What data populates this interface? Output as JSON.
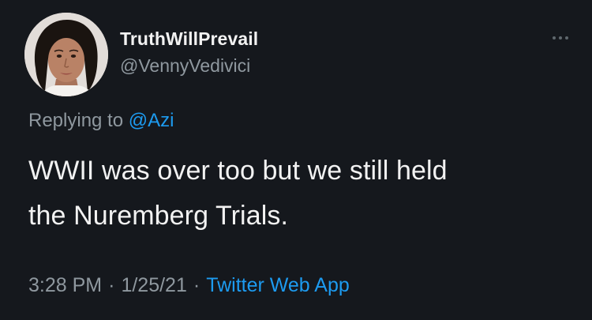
{
  "user": {
    "display_name": "TruthWillPrevail",
    "handle": "@VennyVedivici"
  },
  "reply": {
    "prefix": "Replying to",
    "mention": "@Azi"
  },
  "tweet": {
    "line1": "WWII was over too but we still held",
    "line2": "the Nuremberg Trials."
  },
  "meta": {
    "time": "3:28 PM",
    "separator": "·",
    "date": "1/25/21",
    "source": "Twitter Web App"
  },
  "icons": {
    "more": "more-horizontal-icon"
  },
  "colors": {
    "background": "#15181d",
    "text": "#f2f2f2",
    "secondary": "#8f989f",
    "accent": "#1d9bf0"
  }
}
